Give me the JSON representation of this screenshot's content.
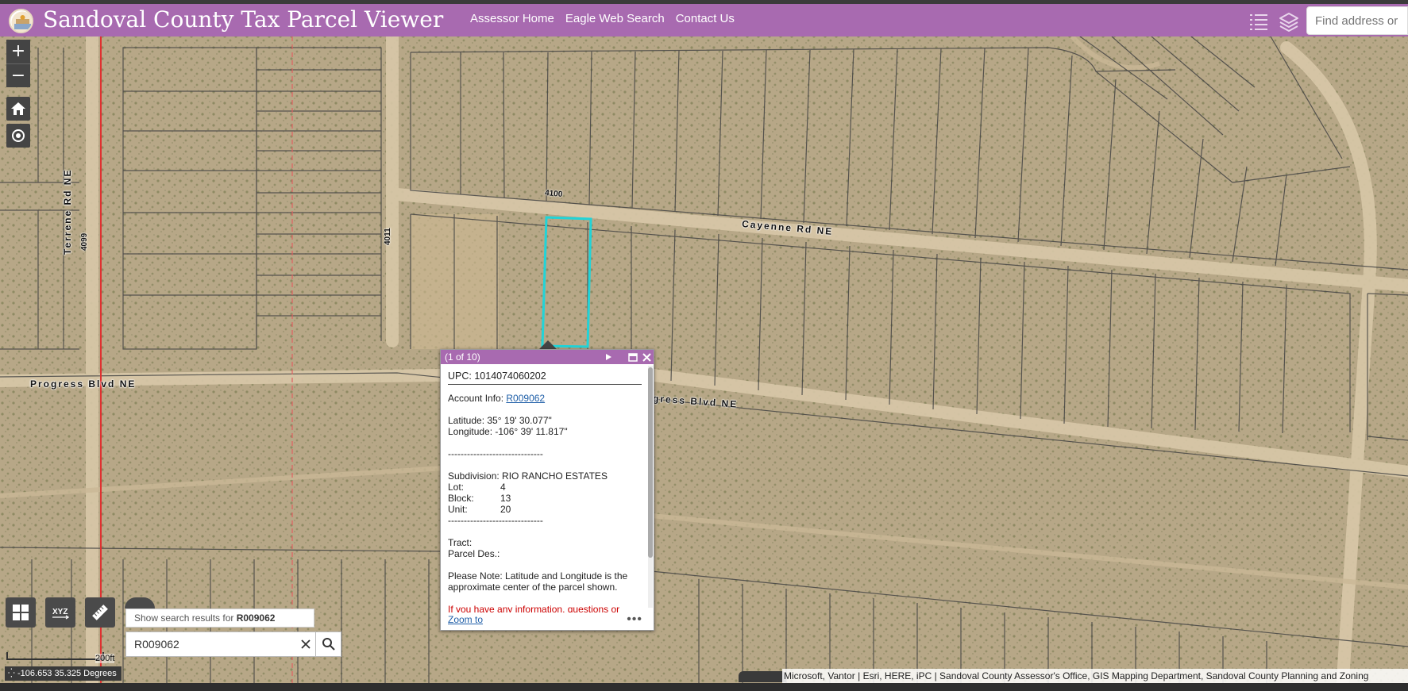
{
  "header": {
    "title": "Sandoval County Tax Parcel Viewer",
    "nav": [
      "Assessor Home",
      "Eagle Web Search",
      "Contact Us"
    ],
    "search_placeholder": "Find address or place"
  },
  "map": {
    "road_labels": [
      "Cayenne Rd NE",
      "Progress Blvd NE",
      "Progress Blvd NE",
      "Terrene Rd NE"
    ],
    "address_labels": [
      "4100",
      "4011",
      "4099"
    ],
    "zoom_in": "+",
    "zoom_out": "−"
  },
  "popup": {
    "counter": "(1 of 10)",
    "upc": "UPC: 1014074060202",
    "account_label": "Account Info:",
    "account_link": "R009062",
    "latitude": "Latitude: 35° 19' 30.077\"",
    "longitude": "Longitude: -106° 39' 11.817\"",
    "divider": "------------------------------",
    "subdivision": "Subdivision: RIO RANCHO ESTATES",
    "lot_label": "Lot:",
    "lot_value": "4",
    "block_label": "Block:",
    "block_value": "13",
    "unit_label": "Unit:",
    "unit_value": "20",
    "tract": "Tract:",
    "parcel_des": "Parcel Des.:",
    "note": "Please Note: Latitude and Longitude is the approximate center of the parcel shown.",
    "contact": "If you have any information, questions or concerns about this parcel, please contact",
    "zoom_to": "Zoom to",
    "more": "•••"
  },
  "search": {
    "suggestion_prefix": "Show search results for ",
    "suggestion_term": "R009062",
    "value": "R009062"
  },
  "scale": {
    "label": "200ft"
  },
  "coords": {
    "text": "-106.653 35.325 Degrees"
  },
  "attribution": "Microsoft, Vantor | Esri, HERE, iPC | Sandoval County Assessor's Office, GIS Mapping Department, Sandoval County Planning and Zoning"
}
